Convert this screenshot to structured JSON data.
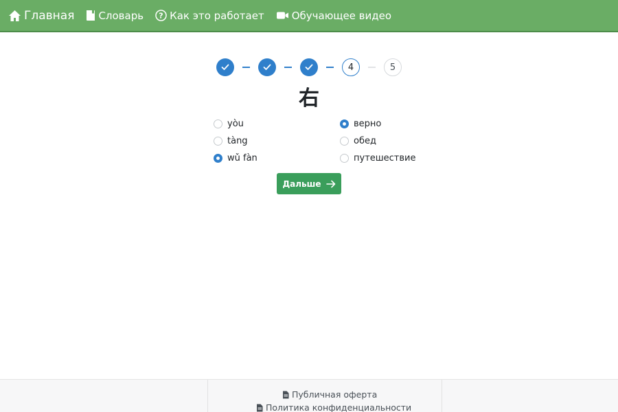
{
  "navbar": {
    "items": [
      {
        "label": "Главная",
        "icon": "home-icon"
      },
      {
        "label": "Словарь",
        "icon": "book-icon"
      },
      {
        "label": "Как это работает",
        "icon": "question-circle-icon"
      },
      {
        "label": "Обучающее видео",
        "icon": "video-camera-icon"
      }
    ]
  },
  "stepper": {
    "steps": [
      {
        "label": "",
        "state": "done"
      },
      {
        "label": "",
        "state": "done"
      },
      {
        "label": "",
        "state": "done"
      },
      {
        "label": "4",
        "state": "current"
      },
      {
        "label": "5",
        "state": "future"
      }
    ]
  },
  "question": {
    "character": "右"
  },
  "options": {
    "pinyin": [
      {
        "label": "yòu",
        "checked": false
      },
      {
        "label": "tàng",
        "checked": false
      },
      {
        "label": "wǔ fàn",
        "checked": true
      }
    ],
    "meaning": [
      {
        "label": "верно",
        "checked": true
      },
      {
        "label": "обед",
        "checked": false
      },
      {
        "label": "путешествие",
        "checked": false
      }
    ]
  },
  "next_button": {
    "label": "Дальше"
  },
  "footer": {
    "links": [
      {
        "label": "Публичная оферта",
        "icon": "document-icon"
      },
      {
        "label": "Политика конфиденциальности",
        "icon": "document-icon"
      }
    ]
  },
  "colors": {
    "navbar": "#6aad65",
    "accent": "#2f7fcb",
    "button": "#3a9e5b"
  }
}
